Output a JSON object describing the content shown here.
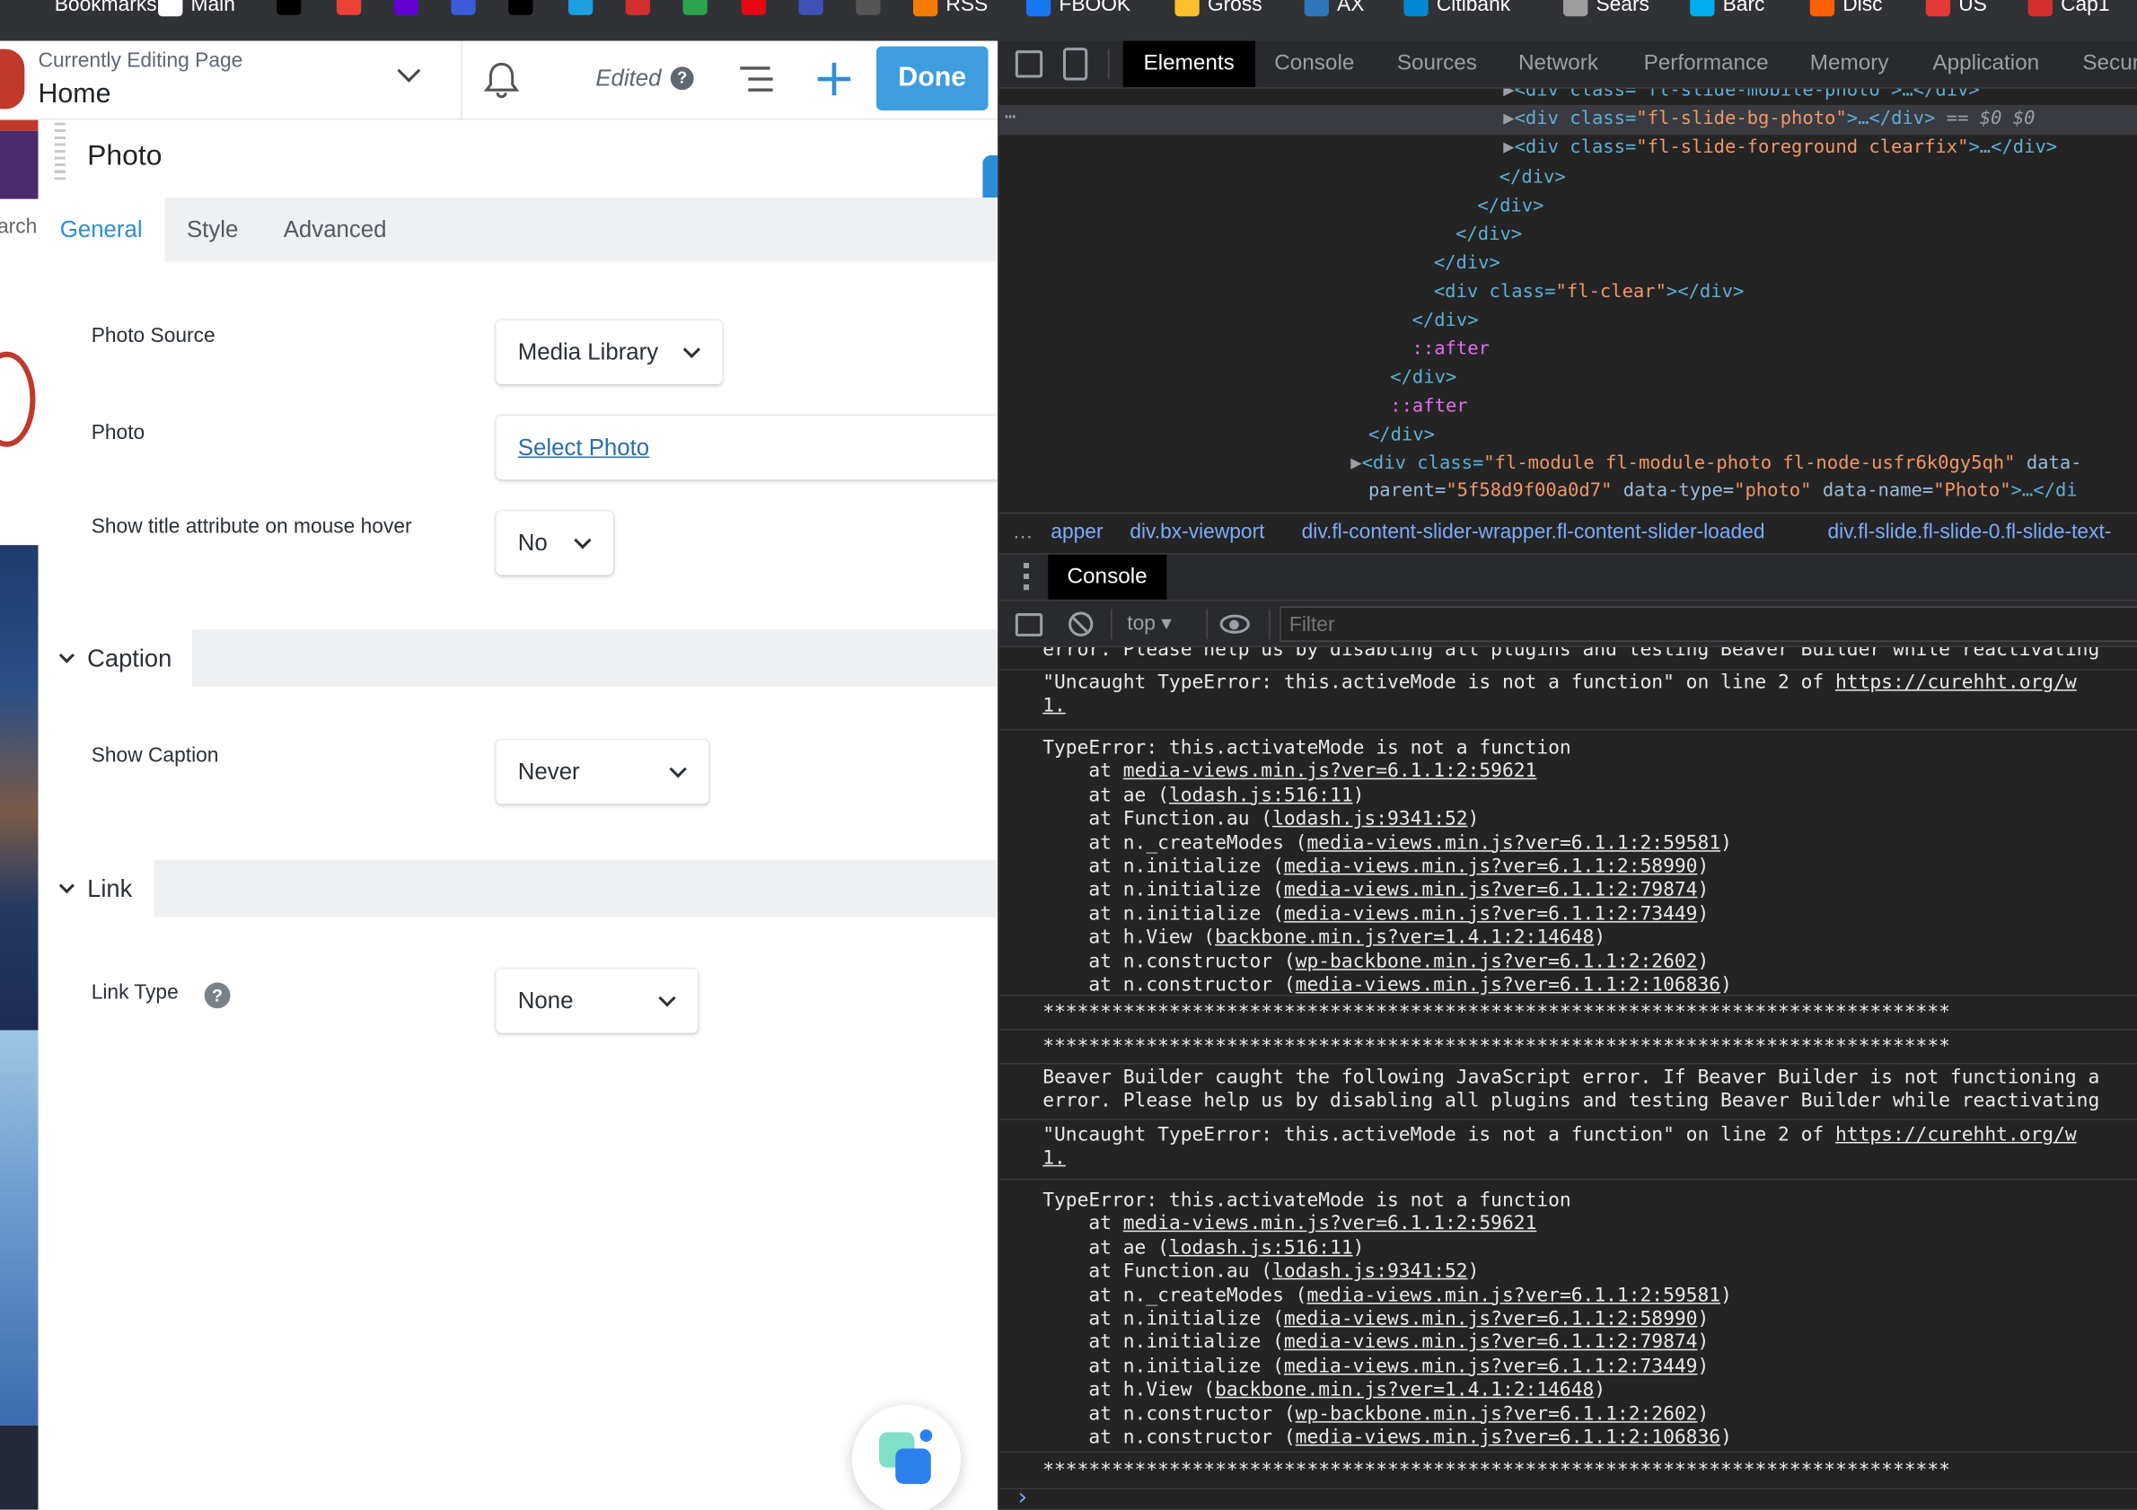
{
  "bookmarks": [
    {
      "label": "Bookmarks",
      "icon": "none",
      "color": "#303236"
    },
    {
      "label": "Main",
      "icon": "folder-icon",
      "color": "#ffffff"
    },
    {
      "label": "",
      "icon": "digg-icon",
      "color": "#000000"
    },
    {
      "label": "",
      "icon": "gmail-icon",
      "color": "#ea4335"
    },
    {
      "label": "",
      "icon": "yahoo-icon",
      "color": "#6001d2"
    },
    {
      "label": "",
      "icon": "s-icon",
      "color": "#3b5bdb"
    },
    {
      "label": "",
      "icon": "e-icon",
      "color": "#000000"
    },
    {
      "label": "",
      "icon": "drop-icon",
      "color": "#1ba0e2"
    },
    {
      "label": "",
      "icon": "c-icon",
      "color": "#d32f2f"
    },
    {
      "label": "",
      "icon": "tc-icon",
      "color": "#2da44e"
    },
    {
      "label": "",
      "icon": "netflix-icon",
      "color": "#e50914"
    },
    {
      "label": "",
      "icon": "dash-icon",
      "color": "#3f51b5"
    },
    {
      "label": "",
      "icon": "g-icon",
      "color": "#555555"
    },
    {
      "label": "RSS",
      "icon": "rss-icon",
      "color": "#f57c00"
    },
    {
      "label": "FBOOK",
      "icon": "facebook-icon",
      "color": "#1877f2"
    },
    {
      "label": "Gross",
      "icon": "chart-icon",
      "color": "#fbc02d"
    },
    {
      "label": "AX",
      "icon": "amex-icon",
      "color": "#2e77bb"
    },
    {
      "label": "Citibank",
      "icon": "citi-icon",
      "color": "#0288d1"
    },
    {
      "label": "Sears",
      "icon": "globe-icon",
      "color": "#9e9e9e"
    },
    {
      "label": "Barc",
      "icon": "barclays-icon",
      "color": "#00aeef"
    },
    {
      "label": "Disc",
      "icon": "discover-icon",
      "color": "#ff6000"
    },
    {
      "label": "US",
      "icon": "shield-icon",
      "color": "#e53935"
    },
    {
      "label": "Cap1",
      "icon": "capone-icon",
      "color": "#d32f2f"
    }
  ],
  "builder": {
    "editing_label": "Currently Editing Page",
    "page_name": "Home",
    "edited_label": "Edited",
    "done_label": "Done",
    "panel_title": "Photo",
    "tabs": [
      "General",
      "Style",
      "Advanced"
    ],
    "strip_text": "arch",
    "fields": {
      "photo_source_label": "Photo Source",
      "photo_source_value": "Media Library",
      "photo_label": "Photo",
      "select_photo_link": "Select Photo",
      "show_title_label": "Show title attribute on mouse hover",
      "show_title_value": "No",
      "caption_section": "Caption",
      "show_caption_label": "Show Caption",
      "show_caption_value": "Never",
      "link_section": "Link",
      "link_type_label": "Link Type",
      "link_type_value": "None"
    }
  },
  "devtools": {
    "tabs": [
      "Elements",
      "Console",
      "Sources",
      "Network",
      "Performance",
      "Memory",
      "Application",
      "Secur"
    ],
    "elements": {
      "line0": "<div class=\"fl-slide-mobile-photo\">…</div>",
      "line1_a": "<div class=",
      "line1_b": "\"fl-slide-bg-photo\"",
      "line1_c": ">…</div>",
      "line1_d": " == $0",
      "line2_a": "<div class=",
      "line2_b": "\"fl-slide-foreground clearfix\"",
      "line2_c": ">…</div>",
      "close_div": "</div>",
      "clear_a": "<div class=",
      "clear_b": "\"fl-clear\"",
      "clear_c": "></div>",
      "after": "::after",
      "module_a": "<div class=",
      "module_b": "\"fl-module fl-module-photo fl-node-usfr6k0gy5qh\"",
      "module_c": " data-",
      "module2_a": "parent=",
      "module2_b": "\"5f58d9f00a0d7\"",
      "module2_c": " data-type=",
      "module2_d": "\"photo\"",
      "module2_e": " data-name=",
      "module2_f": "\"Photo\"",
      "module2_g": ">…</di"
    },
    "breadcrumbs": [
      "apper",
      "div.bx-viewport",
      "div.fl-content-slider-wrapper.fl-content-slider-loaded",
      "div.fl-slide.fl-slide-0.fl-slide-text-"
    ],
    "console_tab": "Console",
    "context": "top",
    "filter_placeholder": "Filter",
    "console": {
      "partial_top": "error. Please help us by disabling all plugins and testing Beaver Builder while reactivating",
      "uncaught_prefix": "\"Uncaught TypeError: this.activeMode is not a function\" on line 2 of ",
      "uncaught_link": "https://curehht.org/w",
      "uncaught_tail": "1.",
      "type_error": "TypeError: this.activateMode is not a function",
      "stack": [
        {
          "pre": "    at ",
          "link": "media-views.min.js?ver=6.1.1:2:59621",
          "post": ""
        },
        {
          "pre": "    at ae (",
          "link": "lodash.js:516:11",
          "post": ")"
        },
        {
          "pre": "    at Function.au (",
          "link": "lodash.js:9341:52",
          "post": ")"
        },
        {
          "pre": "    at n._createModes (",
          "link": "media-views.min.js?ver=6.1.1:2:59581",
          "post": ")"
        },
        {
          "pre": "    at n.initialize (",
          "link": "media-views.min.js?ver=6.1.1:2:58990",
          "post": ")"
        },
        {
          "pre": "    at n.initialize (",
          "link": "media-views.min.js?ver=6.1.1:2:79874",
          "post": ")"
        },
        {
          "pre": "    at n.initialize (",
          "link": "media-views.min.js?ver=6.1.1:2:73449",
          "post": ")"
        },
        {
          "pre": "    at h.View (",
          "link": "backbone.min.js?ver=1.4.1:2:14648",
          "post": ")"
        },
        {
          "pre": "    at n.constructor (",
          "link": "wp-backbone.min.js?ver=6.1.1:2:2602",
          "post": ")"
        },
        {
          "pre": "    at n.constructor (",
          "link": "media-views.min.js?ver=6.1.1:2:106836",
          "post": ")"
        }
      ],
      "stars": "*******************************************************************************",
      "bb_line1": "Beaver Builder caught the following JavaScript error. If Beaver Builder is not functioning a",
      "bb_line2": "error. Please help us by disabling all plugins and testing Beaver Builder while reactivating"
    }
  }
}
